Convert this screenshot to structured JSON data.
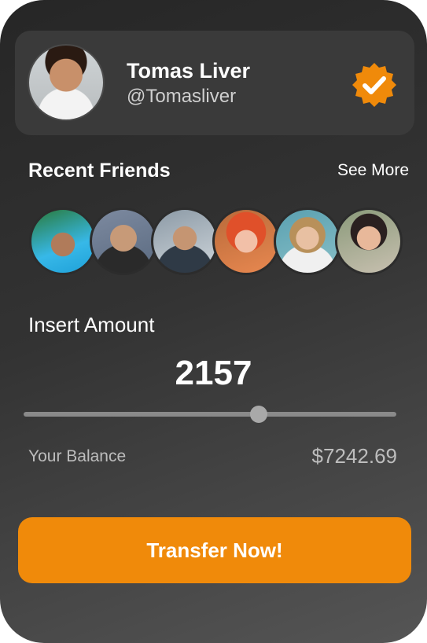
{
  "profile": {
    "name": "Tomas Liver",
    "handle": "@Tomasliver",
    "verified_icon": "verified-badge-icon",
    "verified_color": "#F08A0A"
  },
  "friends": {
    "title": "Recent Friends",
    "see_more_label": "See More",
    "count": 6
  },
  "amount": {
    "label": "Insert Amount",
    "value": "2157",
    "slider_fraction": 0.63
  },
  "balance": {
    "label": "Your Balance",
    "value": "$7242.69"
  },
  "actions": {
    "transfer_label": "Transfer Now!"
  },
  "colors": {
    "accent": "#F08A0A",
    "card_bg_top": "#262626",
    "card_bg_bottom": "#555555",
    "muted_text": "#BDBDBD"
  }
}
